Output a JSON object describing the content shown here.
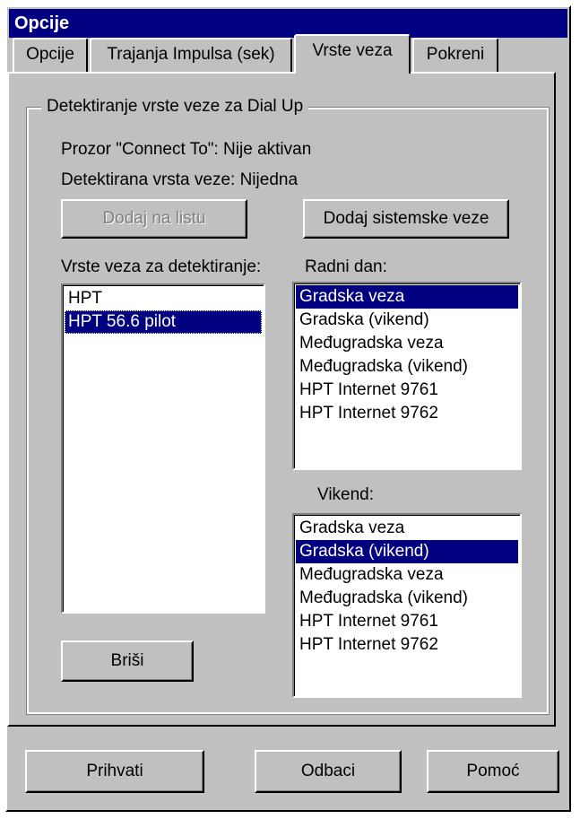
{
  "window": {
    "title": "Opcije"
  },
  "tabs": [
    {
      "label": "Opcije"
    },
    {
      "label": "Trajanja Impulsa (sek)"
    },
    {
      "label": "Vrste veza"
    },
    {
      "label": "Pokreni"
    }
  ],
  "active_tab": "Vrste veza",
  "group": {
    "label": "Detektiranje vrste veze za Dial Up"
  },
  "status": {
    "window_line": "Prozor \"Connect To\": Nije aktivan",
    "detected_line": "Detektirana vrsta veze: Nijedna"
  },
  "buttons": {
    "add_to_list": "Dodaj na listu",
    "add_system": "Dodaj sistemske veze",
    "delete": "Briši",
    "accept": "Prihvati",
    "cancel": "Odbaci",
    "help": "Pomoć"
  },
  "labels": {
    "detect_list": "Vrste veza za detektiranje:",
    "workday": "Radni dan:",
    "weekend": "Vikend:"
  },
  "detect_list": {
    "items": [
      "HPT",
      "HPT 56.6 pilot"
    ],
    "selected": "HPT 56.6 pilot"
  },
  "workday_list": {
    "items": [
      "Gradska veza",
      "Gradska (vikend)",
      "Međugradska veza",
      "Međugradska (vikend)",
      "HPT Internet 9761",
      "HPT Internet 9762"
    ],
    "selected": "Gradska veza"
  },
  "weekend_list": {
    "items": [
      "Gradska veza",
      "Gradska (vikend)",
      "Međugradska veza",
      "Međugradska (vikend)",
      "HPT Internet 9761",
      "HPT Internet 9762"
    ],
    "selected": "Gradska (vikend)"
  },
  "colors": {
    "titlebar": "#000080",
    "face": "#c0c0c0",
    "selection": "#000080"
  }
}
